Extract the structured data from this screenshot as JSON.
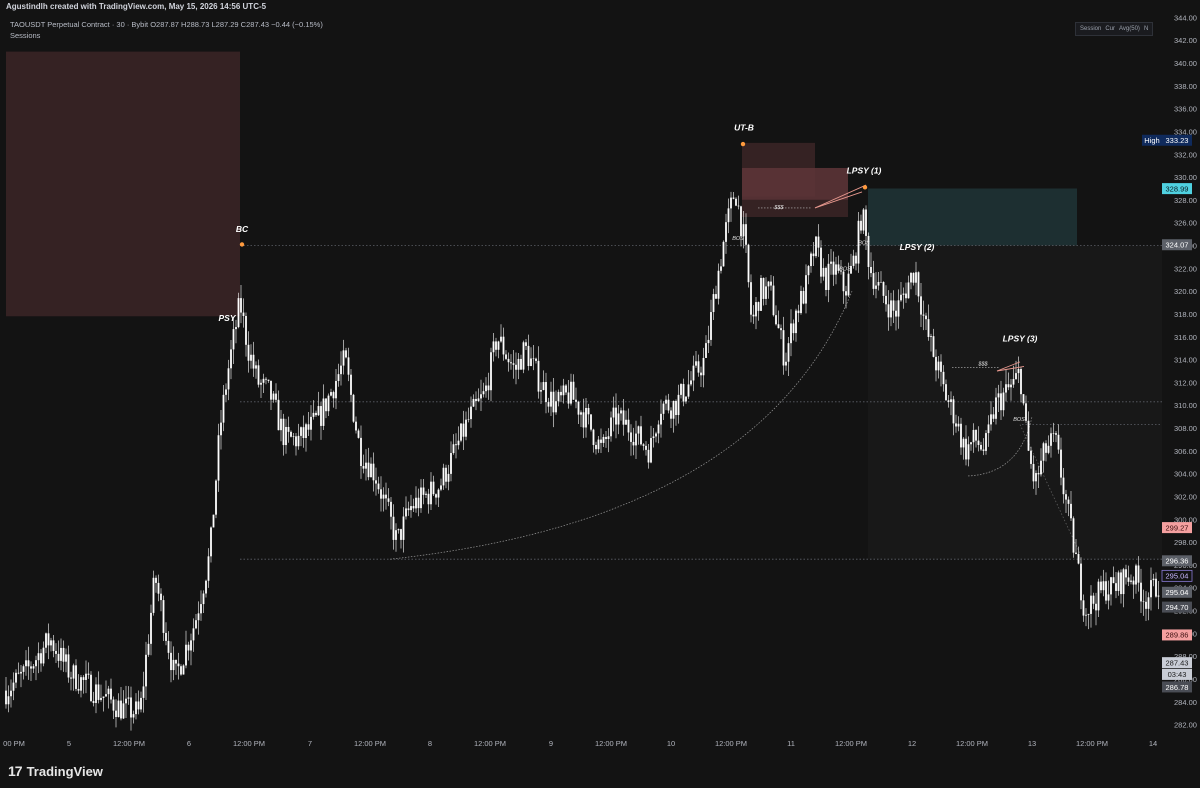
{
  "header": {
    "author_line": "Agustindlh created with TradingView.com, May 15, 2026 14:56 UTC-5",
    "symbol_line": "TAOUSDT Perpetual Contract · 30 · Bybit  O287.87  H288.73  L287.29  C287.43  −0.44 (−0.15%)",
    "sessions_label": "Sessions"
  },
  "indicator_box": [
    "Session",
    "Cur",
    "Avg(50)",
    "N"
  ],
  "footer": {
    "logo": "17",
    "brand": "TradingView"
  },
  "colors": {
    "background": "#131313",
    "candle": "#ffffff",
    "grid_dotted": "#5d6068",
    "supply_zone": "#3a2526",
    "supply_zone_strong": "#5c3437",
    "demand_zone": "#1f3335",
    "high_tag": "#0f2a5c",
    "last_price_tag": "#c9cdd6",
    "cyan_tag": "#4fd1e0",
    "red_tag": "#f5a0a0",
    "orange_marker": "#ff9a3d"
  },
  "chart_data": {
    "type": "candlestick",
    "title": "",
    "ylim": [
      281,
      345
    ],
    "y_ticks": [
      "282.00",
      "284.00",
      "286.00",
      "288.00",
      "290.00",
      "292.00",
      "294.00",
      "296.00",
      "298.00",
      "300.00",
      "302.00",
      "304.00",
      "306.00",
      "308.00",
      "310.00",
      "312.00",
      "314.00",
      "316.00",
      "318.00",
      "320.00",
      "322.00",
      "324.00",
      "326.00",
      "328.00",
      "330.00",
      "332.00",
      "334.00",
      "336.00",
      "338.00",
      "340.00",
      "342.00",
      "344.00"
    ],
    "x_ticks": [
      "00 PM",
      "5",
      "12:00 PM",
      "6",
      "12:00 PM",
      "7",
      "12:00 PM",
      "8",
      "12:00 PM",
      "9",
      "12:00 PM",
      "10",
      "12:00 PM",
      "11",
      "12:00 PM",
      "12",
      "12:00 PM",
      "13",
      "12:00 PM",
      "14"
    ],
    "price_path": [
      [
        0,
        284.5
      ],
      [
        25,
        286.5
      ],
      [
        50,
        289.5
      ],
      [
        70,
        286.5
      ],
      [
        95,
        285
      ],
      [
        120,
        283.5
      ],
      [
        140,
        283
      ],
      [
        155,
        295
      ],
      [
        175,
        286
      ],
      [
        195,
        291
      ],
      [
        210,
        297
      ],
      [
        220,
        308
      ],
      [
        228,
        313
      ],
      [
        240,
        319
      ],
      [
        248,
        315
      ],
      [
        258,
        312
      ],
      [
        270,
        311
      ],
      [
        285,
        307
      ],
      [
        300,
        307
      ],
      [
        320,
        309
      ],
      [
        345,
        314
      ],
      [
        360,
        306
      ],
      [
        375,
        304
      ],
      [
        390,
        300
      ],
      [
        397,
        298
      ],
      [
        410,
        301
      ],
      [
        425,
        302
      ],
      [
        440,
        303
      ],
      [
        455,
        306
      ],
      [
        470,
        309
      ],
      [
        485,
        311
      ],
      [
        497,
        316
      ],
      [
        515,
        313
      ],
      [
        525,
        315
      ],
      [
        540,
        312
      ],
      [
        555,
        310
      ],
      [
        570,
        311
      ],
      [
        585,
        309
      ],
      [
        602,
        306
      ],
      [
        615,
        309
      ],
      [
        630,
        308
      ],
      [
        650,
        306
      ],
      [
        660,
        310
      ],
      [
        675,
        310
      ],
      [
        690,
        312
      ],
      [
        705,
        314
      ],
      [
        715,
        320
      ],
      [
        725,
        325
      ],
      [
        735,
        329
      ],
      [
        745,
        324
      ],
      [
        752,
        317
      ],
      [
        760,
        320
      ],
      [
        770,
        320
      ],
      [
        785,
        314
      ],
      [
        795,
        318
      ],
      [
        805,
        320
      ],
      [
        815,
        324
      ],
      [
        825,
        321
      ],
      [
        835,
        322
      ],
      [
        845,
        320
      ],
      [
        855,
        323
      ],
      [
        862,
        327
      ],
      [
        870,
        322
      ],
      [
        880,
        320
      ],
      [
        895,
        318
      ],
      [
        905,
        320
      ],
      [
        915,
        322
      ],
      [
        925,
        317
      ],
      [
        935,
        314
      ],
      [
        945,
        311
      ],
      [
        955,
        309
      ],
      [
        965,
        306
      ],
      [
        975,
        307
      ],
      [
        985,
        306
      ],
      [
        995,
        310
      ],
      [
        1005,
        311
      ],
      [
        1015,
        312
      ],
      [
        1020,
        313
      ],
      [
        1028,
        306
      ],
      [
        1035,
        303
      ],
      [
        1045,
        306
      ],
      [
        1055,
        307
      ],
      [
        1065,
        302
      ],
      [
        1075,
        297
      ],
      [
        1085,
        292
      ],
      [
        1095,
        293
      ],
      [
        1105,
        294
      ],
      [
        1115,
        294
      ],
      [
        1125,
        295
      ],
      [
        1135,
        295
      ],
      [
        1145,
        293
      ],
      [
        1155,
        294
      ],
      [
        1160,
        294.7
      ]
    ],
    "zones": [
      {
        "kind": "supply",
        "x0": 6,
        "x1": 240,
        "y_top": 341,
        "y_bottom": 317.8
      },
      {
        "kind": "supply",
        "x0": 742,
        "x1": 815,
        "y_top": 333,
        "y_bottom": 328.3
      },
      {
        "kind": "supply-strong",
        "x0": 742,
        "x1": 848,
        "y_top": 330.8,
        "y_bottom": 328
      },
      {
        "kind": "supply",
        "x0": 742,
        "x1": 848,
        "y_top": 328,
        "y_bottom": 326.5
      },
      {
        "kind": "demand",
        "x0": 868,
        "x1": 1077,
        "y_top": 329,
        "y_bottom": 324
      },
      {
        "kind": "supply",
        "x0": 1022,
        "x1": 1162,
        "y_top": 314,
        "y_bottom": 309
      }
    ],
    "levels": [
      {
        "price": 324,
        "x0": 240,
        "x1": 1162,
        "style": "dotted"
      },
      {
        "price": 310.3,
        "x0": 240,
        "x1": 1162,
        "style": "dotted"
      },
      {
        "price": 296.5,
        "x0": 240,
        "x1": 1162,
        "style": "dotted"
      },
      {
        "price": 308.3,
        "x0": 1022,
        "x1": 1162,
        "style": "dotted"
      }
    ],
    "wyckoff_labels": [
      {
        "text": "BC",
        "x": 242,
        "price": 325.2
      },
      {
        "text": "PSY",
        "x": 227,
        "price": 317.4
      },
      {
        "text": "UT-B",
        "x": 744,
        "price": 334.1
      },
      {
        "text": "LPSY (1)",
        "x": 864,
        "price": 330.3
      },
      {
        "text": "LPSY (2)",
        "x": 917,
        "price": 323.6
      },
      {
        "text": "LPSY (3)",
        "x": 1020,
        "price": 315.6
      }
    ],
    "small_labels": [
      {
        "text": "$$$",
        "x": 779,
        "price": 327.2
      },
      {
        "text": "BOS",
        "x": 738,
        "price": 324.5
      },
      {
        "text": "BOS",
        "x": 845,
        "price": 321.8
      },
      {
        "text": "BOS",
        "x": 864,
        "price": 324.1
      },
      {
        "text": "$$$",
        "x": 983,
        "price": 313.5
      },
      {
        "text": "BOS",
        "x": 1019,
        "price": 308.6
      }
    ],
    "markers": [
      {
        "x": 242,
        "price": 324.1
      },
      {
        "x": 743,
        "price": 332.9
      },
      {
        "x": 865,
        "price": 329.1
      }
    ],
    "price_tags": [
      {
        "label": "High",
        "value": "333.23",
        "price": 333.23,
        "style": "high"
      },
      {
        "value": "328.99",
        "price": 328.99,
        "style": "cyan"
      },
      {
        "value": "324.07",
        "price": 324.07,
        "style": "grey"
      },
      {
        "value": "299.27",
        "price": 299.27,
        "style": "red"
      },
      {
        "value": "296.36",
        "price": 296.36,
        "style": "grey"
      },
      {
        "value": "295.04",
        "price": 295.04,
        "style": "outline"
      },
      {
        "value": "295.04",
        "price": 293.6,
        "style": "grey"
      },
      {
        "value": "294.70",
        "price": 292.3,
        "style": "grey-dark"
      },
      {
        "value": "289.86",
        "price": 289.86,
        "style": "red"
      },
      {
        "value": "287.43",
        "price": 287.43,
        "style": "last"
      },
      {
        "value": "03:43",
        "price": 286.4,
        "style": "last"
      },
      {
        "value": "286.78",
        "price": 285.3,
        "style": "grey-dark"
      }
    ]
  }
}
